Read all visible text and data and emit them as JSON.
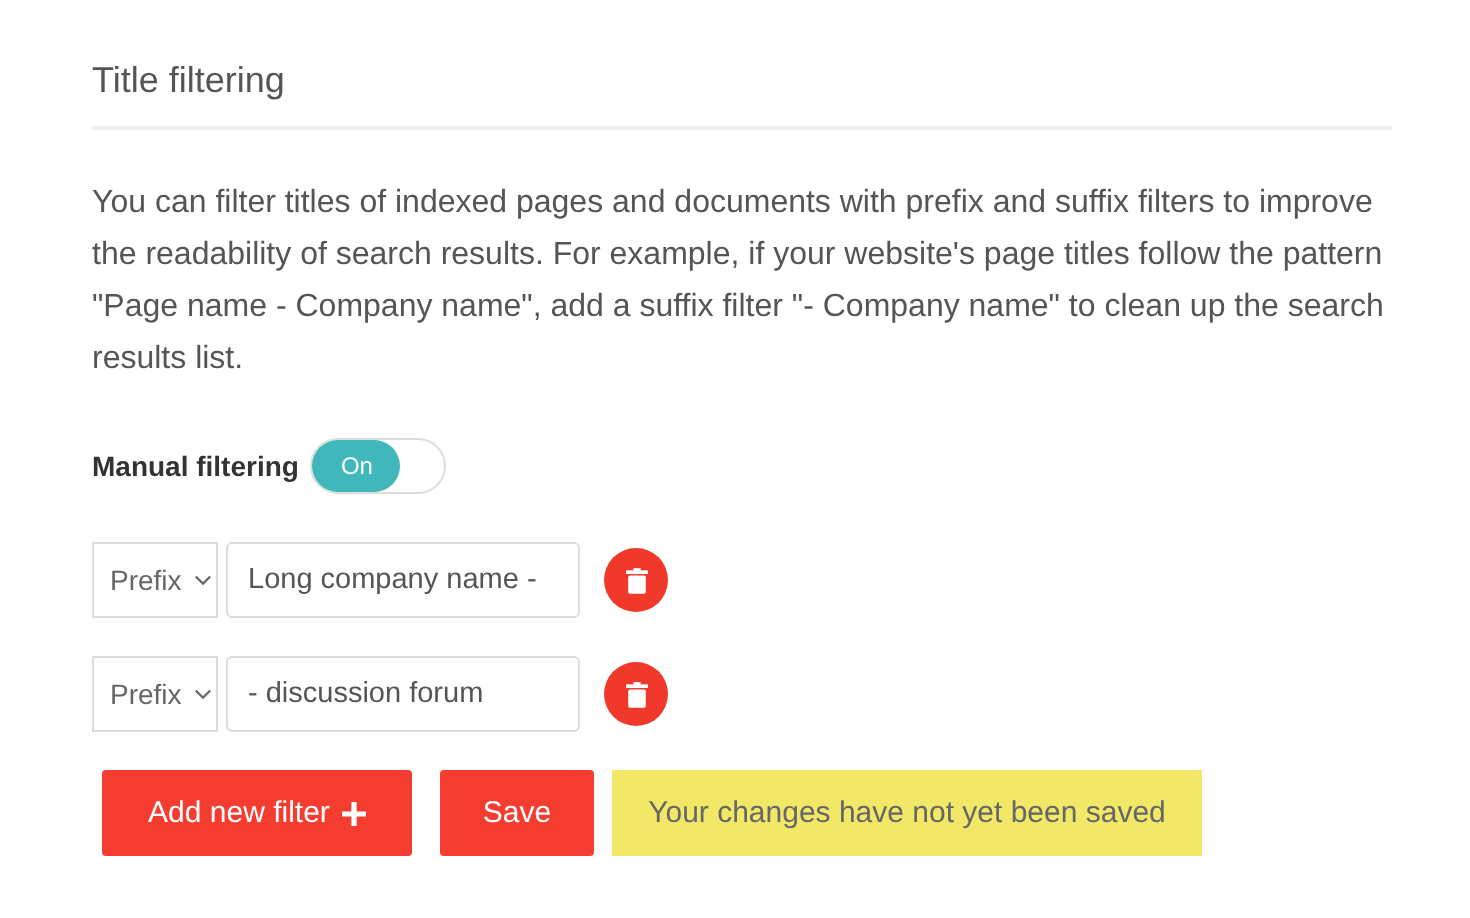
{
  "section": {
    "title": "Title filtering",
    "description": "You can filter titles of indexed pages and documents with prefix and suffix filters to improve the readability of search results. For example, if your website's page titles follow the pattern \"Page name - Company name\", add a suffix filter \"- Company name\" to clean up the search results list."
  },
  "manual_filtering": {
    "label": "Manual filtering",
    "on": true,
    "toggle_text": "On"
  },
  "filters": [
    {
      "type": "Prefix",
      "value": "Long company name -"
    },
    {
      "type": "Prefix",
      "value": "- discussion forum"
    }
  ],
  "buttons": {
    "add": "Add new filter",
    "save": "Save"
  },
  "notice": "Your changes have not yet been saved"
}
